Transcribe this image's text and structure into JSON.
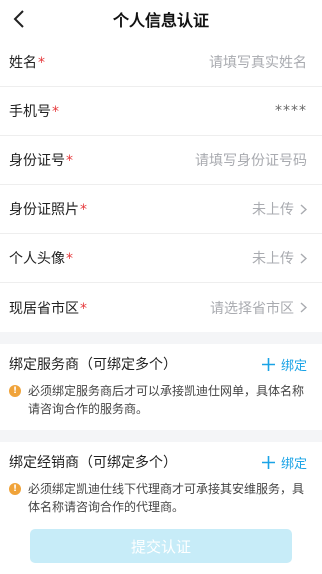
{
  "header": {
    "title": "个人信息认证"
  },
  "form": {
    "rows": [
      {
        "label": "姓名",
        "value": "请填写真实姓名"
      },
      {
        "label": "手机号",
        "value": "****"
      },
      {
        "label": "身份证号",
        "value": "请填写身份证号码"
      },
      {
        "label": "身份证照片",
        "value": "未上传"
      },
      {
        "label": "个人头像",
        "value": "未上传"
      },
      {
        "label": "现居省市区",
        "value": "请选择省市区"
      }
    ],
    "required_mark": "*"
  },
  "service_provider": {
    "title": "绑定服务商（可绑定多个）",
    "bind_label": "绑定",
    "notice": "必须绑定服务商后才可以承接凯迪仕网单，具体名称请咨询合作的服务商。"
  },
  "distributor": {
    "title": "绑定经销商（可绑定多个）",
    "bind_label": "绑定",
    "notice": "必须绑定凯迪仕线下代理商才可承接其安维服务，具体名称请咨询合作的代理商。"
  },
  "footer": {
    "submit_label": "提交认证"
  },
  "colors": {
    "accent": "#1aa3e6",
    "required": "#e6393c",
    "warning": "#f0a33a",
    "submit_disabled": "#c7ecf8"
  }
}
